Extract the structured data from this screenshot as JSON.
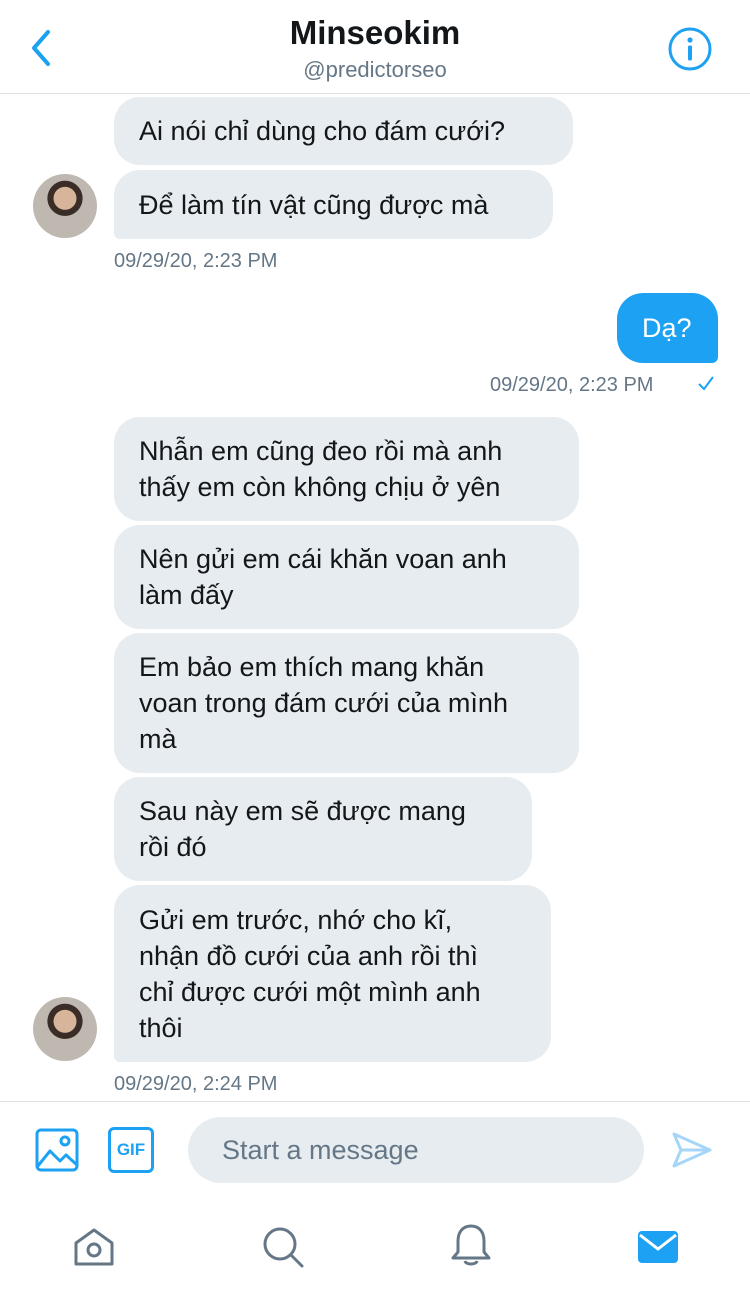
{
  "header": {
    "title": "Minseokim",
    "handle": "@predictorseo"
  },
  "messages": {
    "group1": [
      "Ai nói chỉ dùng cho đám cưới?",
      "Để làm tín vật cũng được mà"
    ],
    "group1_time": "09/29/20, 2:23 PM",
    "mine": "Dạ?",
    "mine_time": "09/29/20, 2:23 PM",
    "group2": [
      "Nhẫn em cũng đeo rồi mà anh\nthấy em còn không chịu ở yên",
      "Nên gửi em cái khăn voan anh\nlàm đấy",
      "Em bảo em thích mang khăn\nvoan trong đám cưới của mình\nmà",
      "Sau này em sẽ được mang\nrồi đó",
      "Gửi em trước, nhớ cho kĩ,\nnhận đồ cưới của anh rồi thì\nchỉ được cưới một mình anh\nthôi"
    ],
    "group2_time": "09/29/20, 2:24 PM"
  },
  "compose": {
    "gif_label": "GIF",
    "placeholder": "Start a message"
  },
  "colors": {
    "accent": "#1da1f2",
    "bubble_gray": "#e6ecf0",
    "muted": "#657786"
  }
}
